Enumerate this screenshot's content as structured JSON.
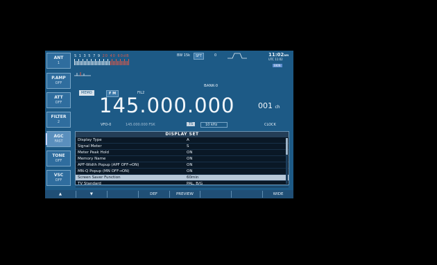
{
  "side_buttons": [
    {
      "label": "ANT",
      "value": "1"
    },
    {
      "label": "P.AMP",
      "value": "OFF"
    },
    {
      "label": "ATT",
      "value": "OFF"
    },
    {
      "label": "FILTER",
      "value": "2"
    },
    {
      "label": "AGC",
      "value": "FAST"
    },
    {
      "label": "TONE",
      "value": "OFF"
    },
    {
      "label": "VSC",
      "value": "OFF"
    }
  ],
  "meter": {
    "scale": "S 1  3  5  7  9",
    "scale_red": "20  40  60dB"
  },
  "status": {
    "bw_label": "BW",
    "bw_value": "15k",
    "sft_label": "SFT",
    "sft_value": "0",
    "time": "11:02",
    "time_suffix": "am",
    "utc": "UTC 11:02",
    "badge": "BKIN"
  },
  "bank": "BANK-0",
  "mode": {
    "memo": "MEMO",
    "mode": "F M",
    "filter": "FIL2"
  },
  "frequency": "145.000.000",
  "channel": {
    "number": "001",
    "unit": "ch"
  },
  "sub": {
    "vfo": "VFO-0",
    "sub_freq": "145.000.000 FSK",
    "ts": "TS",
    "ts_value": "10 kHz",
    "clock": "CLOCK"
  },
  "menu": {
    "title": "DISPLAY SET",
    "rows": [
      {
        "name": "Display Type",
        "value": "A"
      },
      {
        "name": "Signal Meter",
        "value": "S"
      },
      {
        "name": "Meter Peak Hold",
        "value": "ON"
      },
      {
        "name": "Memory Name",
        "value": "ON"
      },
      {
        "name": "APF-Width Popup (APF OFF→ON)",
        "value": "ON"
      },
      {
        "name": "MN-Q Popup (MN OFF→ON)",
        "value": "ON"
      },
      {
        "name": "Screen Saver Function",
        "value": "60min"
      },
      {
        "name": "TV Standard",
        "value": "PAL, B/G"
      }
    ],
    "selected_index": 6
  },
  "function_keys": [
    "▲",
    "▼",
    "",
    "DEF",
    "PREVIEW",
    "",
    "",
    "WIDE"
  ]
}
